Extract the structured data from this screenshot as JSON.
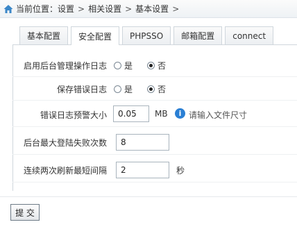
{
  "breadcrumb": {
    "prefix": "当前位置：",
    "items": [
      "设置",
      "相关设置",
      "基本设置"
    ],
    "separator": ">",
    "trailing": ">"
  },
  "tabs": [
    {
      "label": "基本配置",
      "active": false
    },
    {
      "label": "安全配置",
      "active": true
    },
    {
      "label": "PHPSSO",
      "active": false
    },
    {
      "label": "邮箱配置",
      "active": false
    },
    {
      "label": "connect",
      "active": false
    }
  ],
  "form": {
    "admin_log": {
      "label": "启用后台管理操作日志",
      "yes": "是",
      "no": "否",
      "selected": "no"
    },
    "error_log": {
      "label": "保存错误日志",
      "yes": "是",
      "no": "否",
      "selected": "no"
    },
    "error_log_size": {
      "label": "错误日志预警大小",
      "value": "0.05",
      "unit": "MB",
      "hint": "请输入文件尺寸"
    },
    "max_login_fail": {
      "label": "后台最大登陆失败次数",
      "value": "8"
    },
    "min_refresh_interval": {
      "label": "连续两次刷新最短间隔",
      "value": "2",
      "unit": "秒"
    }
  },
  "submit_label": "提 交",
  "colors": {
    "accent": "#2a7fd4",
    "border": "#cfd6dc"
  }
}
